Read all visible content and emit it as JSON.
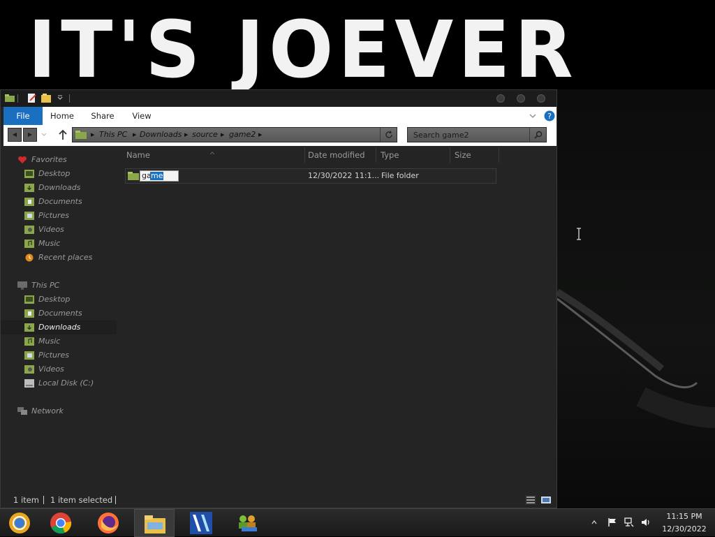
{
  "wallpaper": {
    "text": "IT'S JOEVER"
  },
  "ribbon": {
    "tabs": [
      "File",
      "Home",
      "Share",
      "View"
    ]
  },
  "address": {
    "crumbs": [
      "This PC",
      "Downloads",
      "source",
      "game2"
    ],
    "search_placeholder": "Search game2"
  },
  "nav": {
    "favorites_label": "Favorites",
    "favorites": [
      "Desktop",
      "Downloads",
      "Documents",
      "Pictures",
      "Videos",
      "Music",
      "Recent places"
    ],
    "this_pc_label": "This PC",
    "this_pc": [
      "Desktop",
      "Documents",
      "Downloads",
      "Music",
      "Pictures",
      "Videos",
      "Local Disk (C:)"
    ],
    "network_label": "Network",
    "active_item": "Downloads"
  },
  "columns": [
    "Name",
    "Date modified",
    "Type",
    "Size"
  ],
  "rows": [
    {
      "name_before": "ga",
      "name_selected": "me",
      "date": "12/30/2022 11:1...",
      "type": "File folder",
      "size": ""
    }
  ],
  "status": {
    "count": "1 item",
    "selected": "1 item selected"
  },
  "taskbar": {
    "apps": [
      "chrome-canary-icon",
      "chrome-icon",
      "firefox-icon",
      "file-explorer-icon",
      "app-icon",
      "network-people-icon"
    ],
    "time": "11:15 PM",
    "date": "12/30/2022"
  },
  "colors": {
    "accent": "#1a6fc1",
    "window_bg": "#242424"
  }
}
